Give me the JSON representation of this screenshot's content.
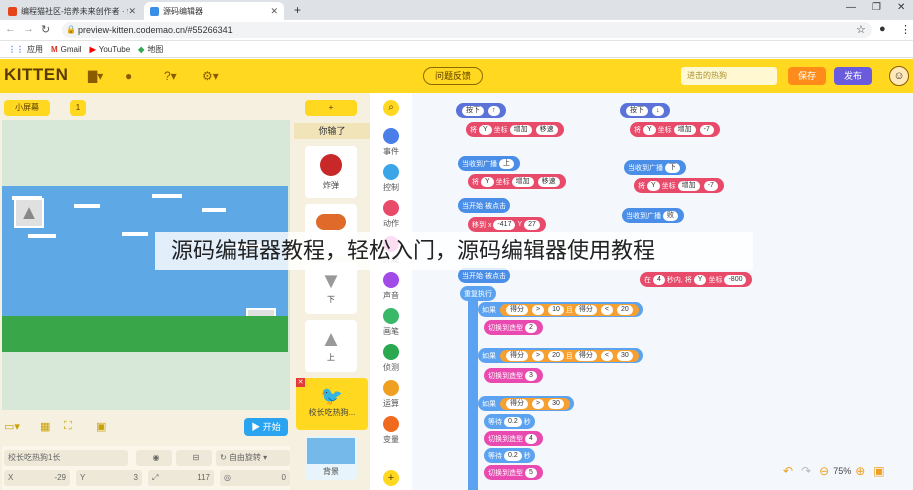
{
  "browser": {
    "tabs": [
      {
        "title": "编程猫社区-培养未来创作者 · 创"
      },
      {
        "title": "源码编辑器"
      }
    ],
    "url": "preview-kitten.codemao.cn/#55266341",
    "bookmarks": [
      "应用",
      "Gmail",
      "YouTube",
      "地图"
    ]
  },
  "header": {
    "logo": "KITTEN",
    "feedback": "问题反馈",
    "search_placeholder": "进击的热狗",
    "save": "保存",
    "publish": "发布"
  },
  "stage": {
    "screen_button": "小屏幕",
    "page_num": "1",
    "start_button": "开始",
    "sprite_name": "校长吃热狗1长",
    "rotation": "自由旋转",
    "x_label": "X",
    "x_value": "-29",
    "y_label": "Y",
    "y_value": "3",
    "size_value": "117",
    "direction_value": "0"
  },
  "actors": {
    "add": "+",
    "title": "你输了",
    "items": [
      "炸弹",
      "",
      "下",
      "上",
      "校长吃热狗...",
      "背景"
    ]
  },
  "categories": [
    "事件",
    "控制",
    "动作",
    "外观",
    "声音",
    "画笔",
    "侦测",
    "运算",
    "变量"
  ],
  "blocks": {
    "press_down": "按下",
    "up_key": "↑",
    "down_key": "↓",
    "turn": "将",
    "y": "Y",
    "coord": "坐标",
    "increase": "增加",
    "speed": "移速",
    "neg7": "-7",
    "on_broadcast": "当收到广播",
    "msg_up": "上",
    "msg_down": "下",
    "msg_lose": "败",
    "on_start": "当开始 被点击",
    "move_to": "移到 x",
    "x_val": "-417",
    "y_val": "27",
    "in": "在",
    "secs": "4",
    "secs_label": "秒内, 将",
    "y_target": "-800",
    "repeat": "重复执行",
    "if": "如果",
    "score": "得分",
    "gt": ">",
    "lt": "<",
    "and": "且",
    "n10": "10",
    "n20": "20",
    "n30": "30",
    "switch_costume": "切换到造型",
    "c2": "2",
    "c3": "3",
    "c4": "4",
    "c5": "5",
    "wait": "等待",
    "w02": "0.2",
    "seconds": "秒"
  },
  "zoom": {
    "value": "75%"
  },
  "overlay_text": "源码编辑器教程，轻松入门，源码编辑器使用教程"
}
